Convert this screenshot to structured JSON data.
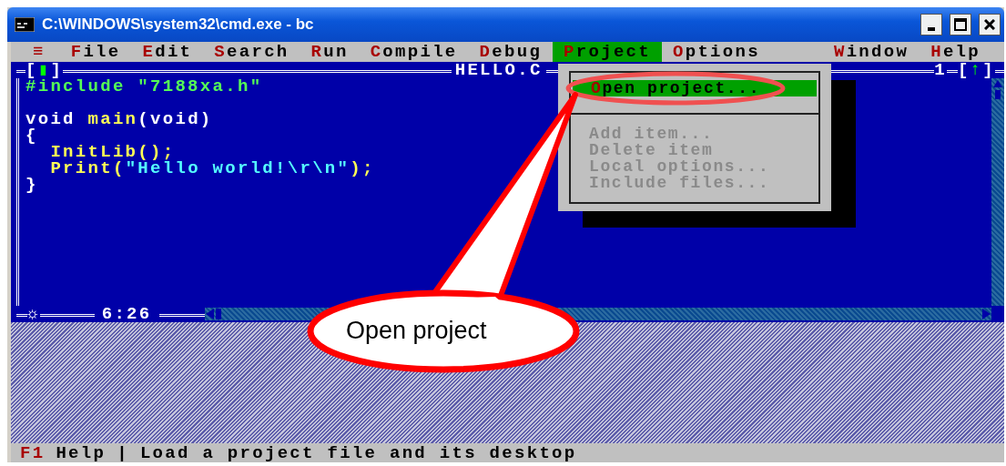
{
  "window": {
    "title": "C:\\WINDOWS\\system32\\cmd.exe - bc"
  },
  "menu_bar": [
    {
      "label": "≡",
      "selected": false
    },
    {
      "label": "File",
      "selected": false
    },
    {
      "label": "Edit",
      "selected": false
    },
    {
      "label": "Search",
      "selected": false
    },
    {
      "label": "Run",
      "selected": false
    },
    {
      "label": "Compile",
      "selected": false
    },
    {
      "label": "Debug",
      "selected": false
    },
    {
      "label": "Project",
      "selected": true
    },
    {
      "label": "Options",
      "selected": false
    },
    {
      "label": "Window",
      "selected": false
    },
    {
      "label": "Help",
      "selected": false
    }
  ],
  "editor": {
    "close_box": "[▮]",
    "title": "HELLO.C",
    "window_number": "1",
    "zoom_box": "[↑]",
    "modified_mark": "☼",
    "cursor_position": "6:26",
    "lines": [
      {
        "kind": "code",
        "tokens": [
          {
            "text": "#include \"7188xa.h\"",
            "kind": "directive"
          }
        ]
      },
      {
        "kind": "blank"
      },
      {
        "kind": "code",
        "tokens": [
          {
            "text": "void ",
            "kind": "keyword"
          },
          {
            "text": "main",
            "kind": "ident"
          },
          {
            "text": "(void)",
            "kind": "keyword"
          }
        ]
      },
      {
        "kind": "code",
        "tokens": [
          {
            "text": "{",
            "kind": "punct"
          }
        ]
      },
      {
        "kind": "code",
        "tokens": [
          {
            "text": "  InitLib();",
            "kind": "ident"
          }
        ]
      },
      {
        "kind": "code",
        "tokens": [
          {
            "text": "  Print(",
            "kind": "ident"
          },
          {
            "text": "\"Hello world!\\r\\n\"",
            "kind": "string"
          },
          {
            "text": ");",
            "kind": "ident"
          }
        ]
      },
      {
        "kind": "code",
        "tokens": [
          {
            "text": "}",
            "kind": "punct"
          }
        ]
      }
    ]
  },
  "project_menu": [
    {
      "kind": "item",
      "label": "Open project...",
      "selected": true,
      "disabled": false
    },
    {
      "kind": "separator"
    },
    {
      "kind": "item",
      "label": "Add item...",
      "selected": false,
      "disabled": true
    },
    {
      "kind": "item",
      "label": "Delete item",
      "selected": false,
      "disabled": true
    },
    {
      "kind": "item",
      "label": "Local options...",
      "selected": false,
      "disabled": true
    },
    {
      "kind": "item",
      "label": "Include files...",
      "selected": false,
      "disabled": true
    }
  ],
  "status_bar": {
    "key": "F1",
    "label": "Help",
    "separator": "|",
    "message": "Load a project file and its desktop"
  },
  "callout": {
    "text": "Open project"
  }
}
